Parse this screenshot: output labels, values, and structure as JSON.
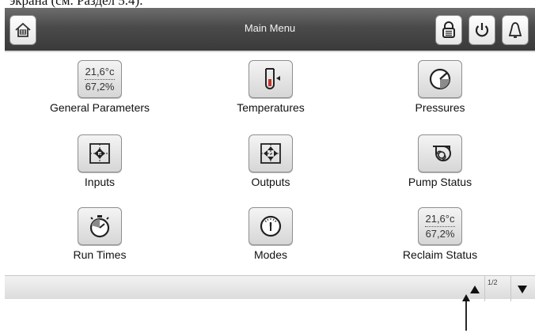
{
  "caption": "экрана (см. Раздел 5.4).",
  "header": {
    "title": "Main Menu"
  },
  "icons": {
    "home": "home-icon",
    "lock": "lock-icon",
    "power": "power-icon",
    "alarm": "alarm-bell-icon"
  },
  "menu": {
    "general_parameters": {
      "label": "General Parameters",
      "readout_top": "21,6°c",
      "readout_bottom": "67,2%"
    },
    "temperatures": {
      "label": "Temperatures"
    },
    "pressures": {
      "label": "Pressures"
    },
    "inputs": {
      "label": "Inputs"
    },
    "outputs": {
      "label": "Outputs"
    },
    "pump_status": {
      "label": "Pump Status"
    },
    "run_times": {
      "label": "Run Times"
    },
    "modes": {
      "label": "Modes"
    },
    "reclaim_status": {
      "label": "Reclaim Status",
      "readout_top": "21,6°c",
      "readout_bottom": "67,2%"
    }
  },
  "pagination": {
    "page": "1/2"
  },
  "colors": {
    "header_bg": "#4a4a4a",
    "tile_bg": "#e2e2e2",
    "footer_bg": "#e6e6e6"
  }
}
